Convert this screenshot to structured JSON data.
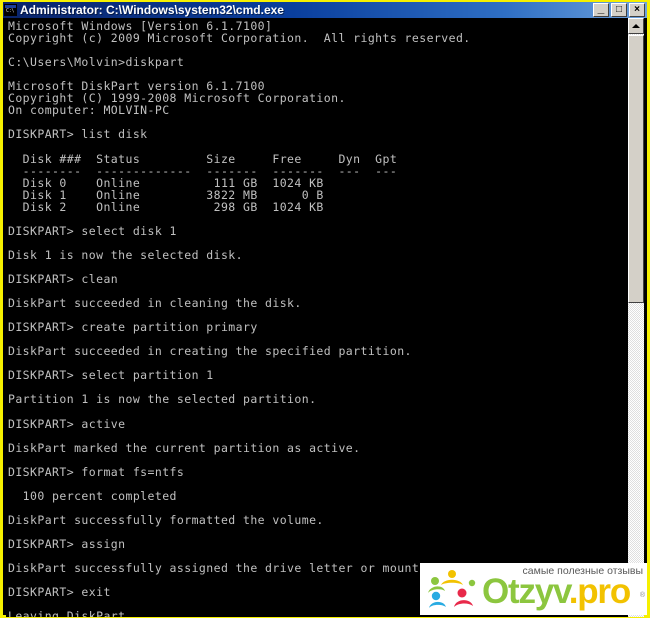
{
  "window": {
    "title": "Administrator: C:\\Windows\\system32\\cmd.exe",
    "icon_label": "C:\\",
    "icon_name": "cmd-console-icon",
    "buttons": {
      "minimize": "_",
      "maximize": "□",
      "close": "×"
    },
    "colors": {
      "titlebar_start": "#0a246a",
      "titlebar_end": "#6ea2dd",
      "frame_border": "#f6f000",
      "console_bg": "#000000",
      "console_fg": "#c0c0c0"
    }
  },
  "console": {
    "header": {
      "os_version": "Microsoft Windows [Version 6.1.7100]",
      "os_copyright": "Copyright (c) 2009 Microsoft Corporation.  All rights reserved.",
      "prompt_path": "C:\\Users\\Molvin>",
      "launch_command": "diskpart",
      "diskpart_version": "Microsoft DiskPart version 6.1.7100",
      "diskpart_copyright": "Copyright (C) 1999-2008 Microsoft Corporation.",
      "computer": "On computer: MOLVIN-PC"
    },
    "prompt": "DISKPART>",
    "disk_table": {
      "headers": [
        "Disk ###",
        "Status",
        "Size",
        "Free",
        "Dyn",
        "Gpt"
      ],
      "rules": [
        "--------",
        "-------------",
        "-------",
        "-------",
        "---",
        "---"
      ],
      "rows": [
        {
          "disk": "Disk 0",
          "status": "Online",
          "size": "111 GB",
          "free": "1024 KB",
          "dyn": "",
          "gpt": ""
        },
        {
          "disk": "Disk 1",
          "status": "Online",
          "size": "3822 MB",
          "free": "0 B",
          "dyn": "",
          "gpt": ""
        },
        {
          "disk": "Disk 2",
          "status": "Online",
          "size": "298 GB",
          "free": "1024 KB",
          "dyn": "",
          "gpt": ""
        }
      ]
    },
    "commands": [
      "list disk",
      "select disk 1",
      "clean",
      "create partition primary",
      "select partition 1",
      "active",
      "format fs=ntfs",
      "assign",
      "exit"
    ],
    "responses": [
      "Disk 1 is now the selected disk.",
      "DiskPart succeeded in cleaning the disk.",
      "DiskPart succeeded in creating the specified partition.",
      "Partition 1 is now the selected partition.",
      "DiskPart marked the current partition as active.",
      "  100 percent completed",
      "DiskPart successfully formatted the volume.",
      "DiskPart successfully assigned the drive letter or mount point.",
      "Leaving DiskPart..."
    ],
    "transcript": "Microsoft Windows [Version 6.1.7100]\nCopyright (c) 2009 Microsoft Corporation.  All rights reserved.\n\nC:\\Users\\Molvin>diskpart\n\nMicrosoft DiskPart version 6.1.7100\nCopyright (C) 1999-2008 Microsoft Corporation.\nOn computer: MOLVIN-PC\n\nDISKPART> list disk\n\n  Disk ###  Status         Size     Free     Dyn  Gpt\n  --------  -------------  -------  -------  ---  ---\n  Disk 0    Online          111 GB  1024 KB\n  Disk 1    Online         3822 MB      0 B\n  Disk 2    Online          298 GB  1024 KB\n\nDISKPART> select disk 1\n\nDisk 1 is now the selected disk.\n\nDISKPART> clean\n\nDiskPart succeeded in cleaning the disk.\n\nDISKPART> create partition primary\n\nDiskPart succeeded in creating the specified partition.\n\nDISKPART> select partition 1\n\nPartition 1 is now the selected partition.\n\nDISKPART> active\n\nDiskPart marked the current partition as active.\n\nDISKPART> format fs=ntfs\n\n  100 percent completed\n\nDiskPart successfully formatted the volume.\n\nDISKPART> assign\n\nDiskPart successfully assigned the drive letter or mount point.\n\nDISKPART> exit\n\nLeaving DiskPart..."
  },
  "scrollbar": {
    "up_arrow": "▲",
    "thumb_position_percent": 3
  },
  "watermark": {
    "tagline": "самые полезные отзывы",
    "brand_main": "Otzyv",
    "brand_suffix": ".pro",
    "registered": "®",
    "colors": {
      "green": "#8cc63f",
      "yellow": "#f2c200",
      "red": "#e8294a",
      "blue": "#29abe2"
    }
  }
}
